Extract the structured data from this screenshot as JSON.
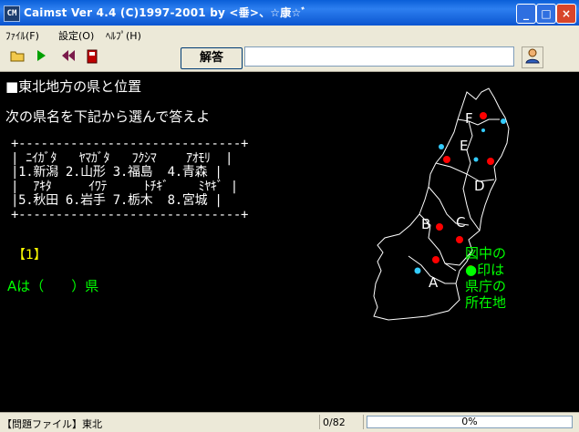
{
  "window": {
    "title": "Caimst Ver 4.4 (C)1997-2001  by <垂>、☆康☆ﾞ",
    "app_icon": "caimst-app-icon",
    "minimize": "_",
    "maximize": "□",
    "close": "×"
  },
  "menu": {
    "file": "ﾌｧｲﾙ(F)",
    "settings": "設定(O)",
    "help": "ﾍﾙﾌﾟ(H)"
  },
  "toolbar": {
    "open_icon": "open-folder-icon",
    "play_icon": "play-icon",
    "rewind_icon": "rewind-icon",
    "stop_icon": "device-icon",
    "answer_label": "解答",
    "answer_value": "",
    "hint_icon": "teacher-icon"
  },
  "content": {
    "heading": "■東北地方の県と位置",
    "instruction": "次の県名を下記から選んで答えよ",
    "choices_table": "+------------------------------+\n| ﾆｲｶﾞﾀ   ﾔﾏｶﾞﾀ   ﾌｸｼﾏ    ｱｵﾓﾘ  |\n|1.新潟 2.山形 3.福島  4.青森 |\n|  ｱｷﾀ     ｲﾜﾃ     ﾄﾁｷﾞ    ﾐﾔｷﾞ |\n|5.秋田 6.岩手 7.栃木  8.宮城 |\n+------------------------------+",
    "question_number": "【1】",
    "question_text": "Aは（　　）県"
  },
  "map": {
    "labels": [
      "F",
      "E",
      "D",
      "C",
      "B",
      "A"
    ],
    "note": [
      "図中の",
      "●印は",
      "県庁の",
      "所在地"
    ],
    "capital_color": "#ff0000",
    "lake_color": "#33ccff",
    "outline_color": "#ffffff"
  },
  "status": {
    "file": "【問題ファイル】東北",
    "count": "0/82",
    "progress_text": "0%",
    "progress": 0
  },
  "colors": {
    "question_text": "#00ff00",
    "question_number": "#ffff00",
    "background": "#000000"
  }
}
